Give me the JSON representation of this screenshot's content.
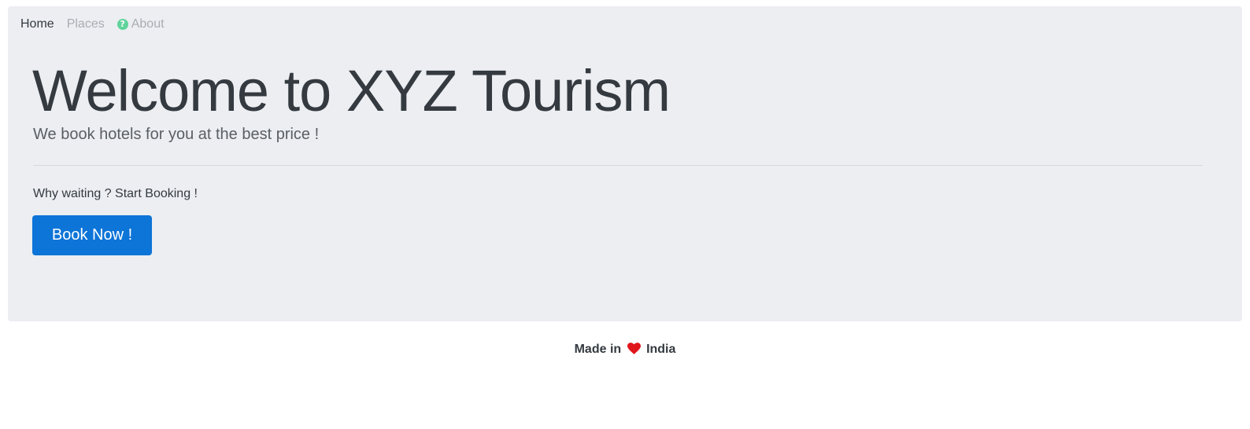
{
  "nav": {
    "items": [
      {
        "label": "Home",
        "icon": null,
        "state": "active"
      },
      {
        "label": "Places",
        "icon": null,
        "state": "muted"
      },
      {
        "label": "About",
        "icon": "question-circle-icon",
        "state": "muted"
      }
    ]
  },
  "hero": {
    "title": "Welcome to XYZ Tourism",
    "subtitle": "We book hotels for you at the best price !",
    "cta_text": "Why waiting ? Start Booking !",
    "button_label": "Book Now !"
  },
  "footer": {
    "prefix": "Made in",
    "icon": "heart-icon",
    "suffix": "India"
  },
  "colors": {
    "jumbotron_bg": "#eceef1",
    "primary_button": "#0d74d8",
    "heart": "#e0161b",
    "help_icon": "#5fd39b",
    "muted_link": "#a9adb2",
    "text": "#343a40"
  }
}
